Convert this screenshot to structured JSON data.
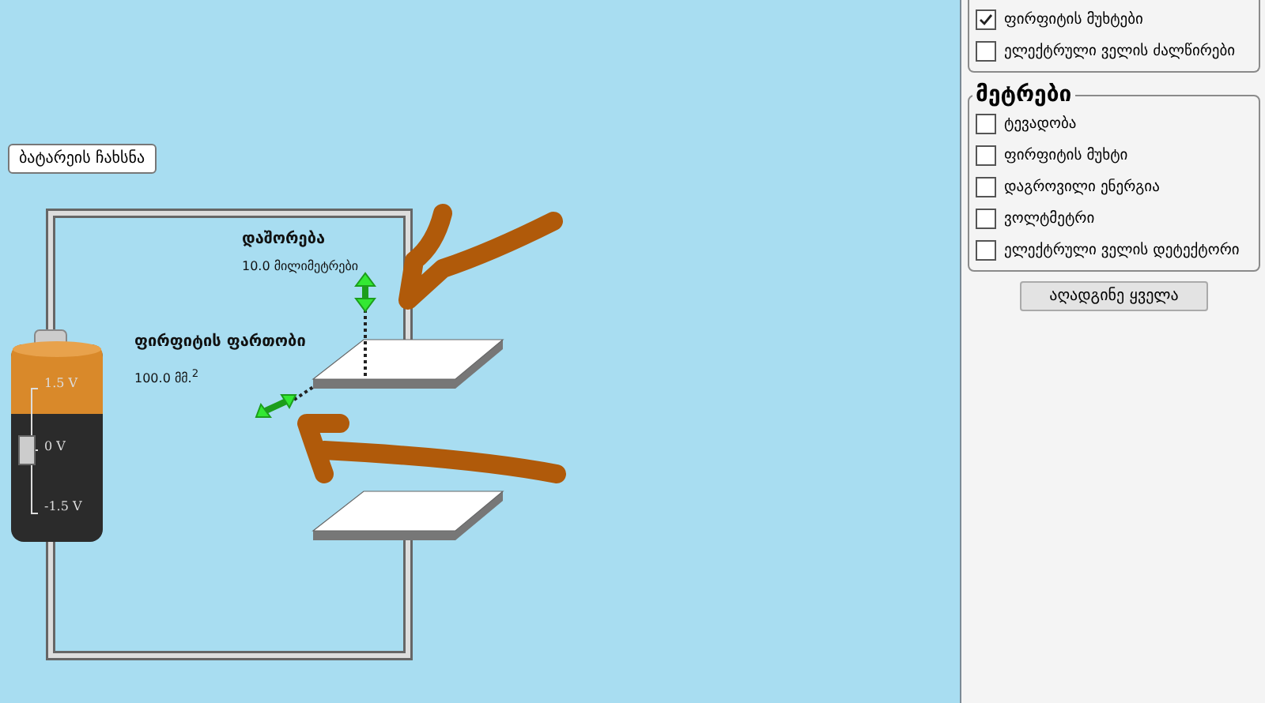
{
  "battery_button": {
    "label": "ბატარეის ჩახსნა"
  },
  "separation": {
    "label": "დაშორება",
    "value": "10.0 მილიმეტრები"
  },
  "plate_area": {
    "label": "ფირფიტის ფართობი",
    "value": "100.0 მმ.$^{2}$"
  },
  "battery": {
    "labels": [
      "1.5 V",
      "0 V",
      "-1.5 V"
    ]
  },
  "view_options": [
    {
      "label": "ფირფიტის მუხტები",
      "checked": true
    },
    {
      "label": "ელექტრული ველის ძალწირები",
      "checked": false
    }
  ],
  "meters": {
    "title": "მეტრები",
    "items": [
      {
        "label": "ტევადობა",
        "checked": false
      },
      {
        "label": "ფირფიტის მუხტი",
        "checked": false
      },
      {
        "label": "დაგროვილი ენერგია",
        "checked": false
      },
      {
        "label": "ვოლტმეტრი",
        "checked": false
      },
      {
        "label": "ელექტრული ველის დეტექტორი",
        "checked": false
      }
    ]
  },
  "reset_button": {
    "label": "აღადგინე ყველა"
  }
}
